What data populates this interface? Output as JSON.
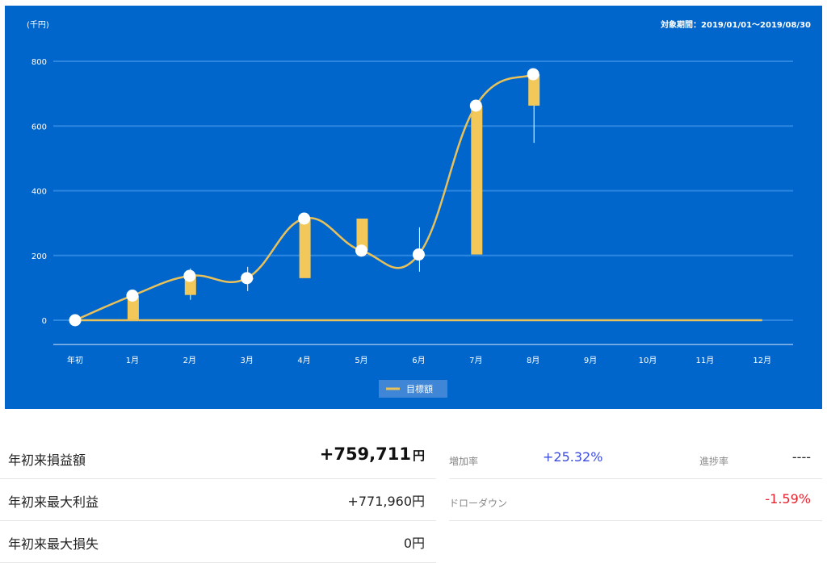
{
  "chart": {
    "unit_label": "(千円)",
    "period_label": "対象期間：2019/01/01〜2019/08/30",
    "legend_label": "目標額"
  },
  "chart_data": {
    "type": "line",
    "categories": [
      "年初",
      "1月",
      "2月",
      "3月",
      "4月",
      "5月",
      "6月",
      "7月",
      "8月",
      "9月",
      "10月",
      "11月",
      "12月"
    ],
    "ylim": [
      -75,
      830
    ],
    "yticks": [
      0,
      200,
      400,
      600,
      800
    ],
    "grid": true,
    "legend_position": "bottom",
    "series": [
      {
        "name": "目標額",
        "type": "line",
        "color": "#e8c15a",
        "values": [
          0,
          0,
          0,
          0,
          0,
          0,
          0,
          0,
          0,
          0,
          0,
          0,
          0
        ]
      }
    ],
    "balance_points": [
      0,
      76,
      137,
      130,
      314,
      215,
      203,
      663,
      760
    ],
    "candles": [
      {
        "open": 0,
        "close": 76,
        "high": 76,
        "low": 0
      },
      {
        "open": 78,
        "close": 137,
        "high": 160,
        "low": 63
      },
      {
        "open": 130,
        "close": 130,
        "high": 165,
        "low": 90
      },
      {
        "open": 130,
        "close": 314,
        "high": 314,
        "low": 130
      },
      {
        "open": 314,
        "close": 215,
        "high": 314,
        "low": 215
      },
      {
        "open": 203,
        "close": 203,
        "high": 287,
        "low": 150
      },
      {
        "open": 203,
        "close": 663,
        "high": 663,
        "low": 203
      },
      {
        "open": 663,
        "close": 760,
        "high": 760,
        "low": 548
      }
    ],
    "colors": {
      "panel": "#0066cc",
      "candle": "#f2c85b",
      "line": "#e8c15a",
      "grid": "#2d86e0",
      "marker": "#ffffff"
    }
  },
  "stats": {
    "ytd_pl_label": "年初来損益額",
    "ytd_pl_value": "+759,711",
    "yen": "円",
    "max_profit_label": "年初来最大利益",
    "max_profit_value": "+771,960円",
    "max_loss_label": "年初来最大損失",
    "max_loss_value": "0円",
    "increase_label": "増加率",
    "increase_value": "+25.32%",
    "progress_label": "進捗率",
    "progress_value": "----",
    "drawdown_label": "ドローダウン",
    "drawdown_value": "-1.59%"
  }
}
